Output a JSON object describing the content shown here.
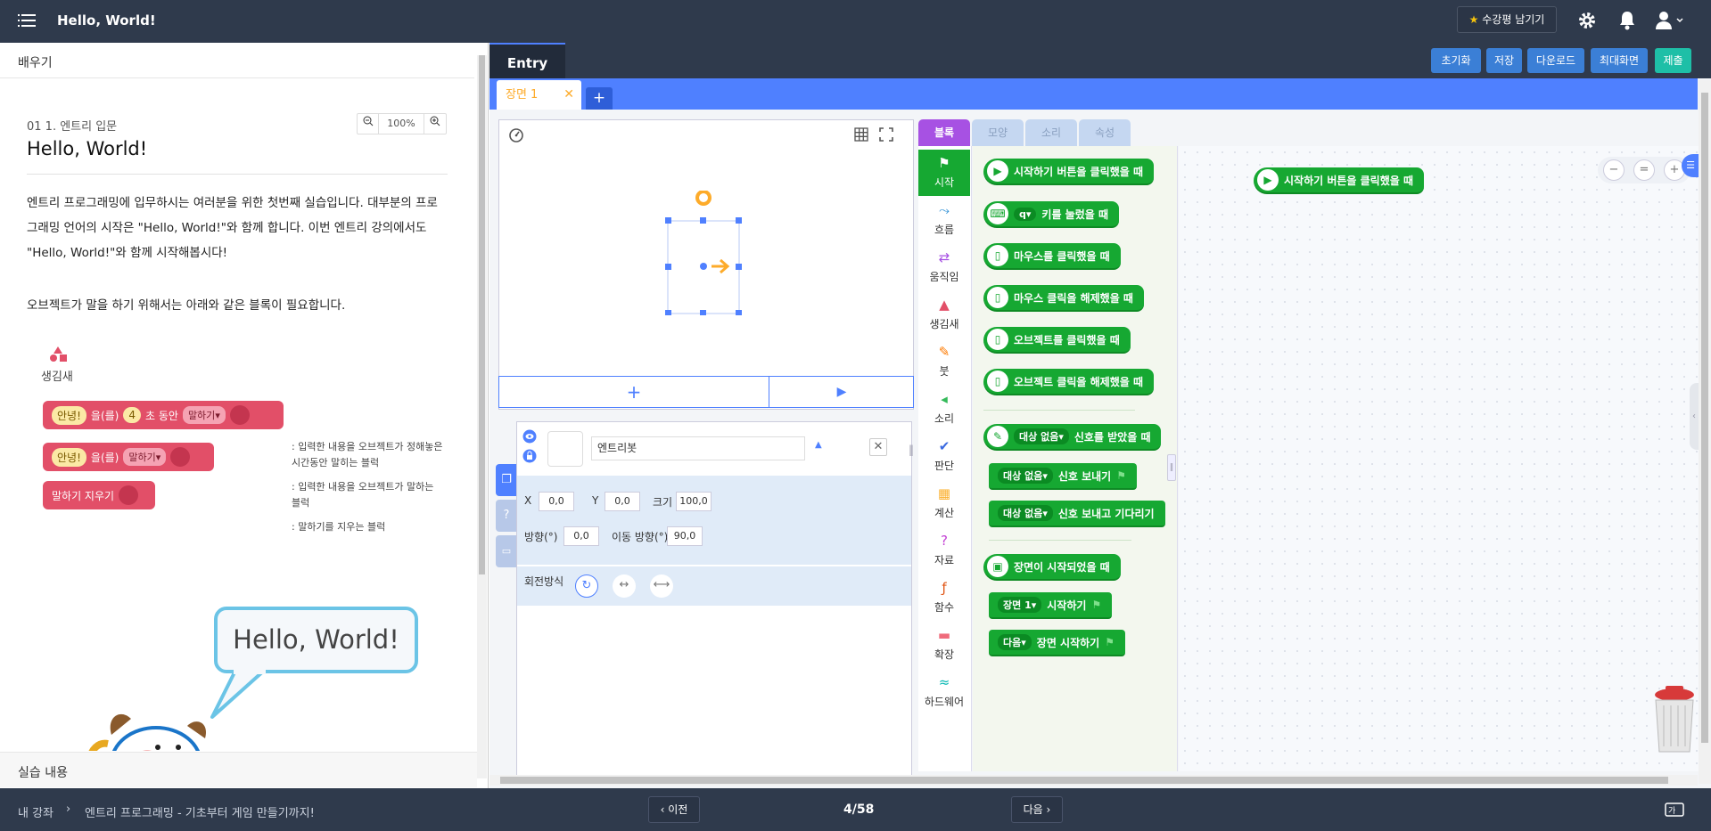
{
  "header": {
    "title": "Hello, World!",
    "review_button": "수강평 남기기"
  },
  "left_panel": {
    "tab_label": "배우기",
    "lesson_subtitle": "01 1. 엔트리 입문",
    "zoom_level": "100%",
    "lesson_title": "Hello, World!",
    "paragraph1": "엔트리 프로그래밍에 입무하시는 여러분을 위한 첫번째 실습입니다. 대부분의 프로그래밍 언어의 시작은 \"Hello, World!\"와 함께 합니다. 이번 엔트리 강의에서도 \"Hello, World!\"와 함께 시작해봅시다!",
    "paragraph2": "오브젝트가 말을 하기 위해서는 아래와 같은 블록이 필요합니다.",
    "shape_category": "생김새",
    "example_blocks": [
      {
        "text1": "안녕!",
        "text2": "을(를)",
        "num": "4",
        "text3": "초 동안",
        "dropdown": "말하기",
        "desc": ": 입력한 내용을 오브젝트가 정해놓은 시간동안 말히는 블럭"
      },
      {
        "text1": "안녕!",
        "text2": "을(를)",
        "dropdown": "말하기",
        "desc": ": 입력한 내용을 오브젝트가 말하는 블럭"
      },
      {
        "text1": "말하기 지우기",
        "desc": ": 말하기를 지우는 블럭"
      }
    ],
    "speech_bubble": "Hello, World!",
    "practice_label": "실습 내용"
  },
  "entry": {
    "tab_label": "Entry",
    "buttons": {
      "reset": "초기화",
      "save": "저장",
      "download": "다운로드",
      "maximize": "최대화면",
      "submit": "제출"
    },
    "scene_tab": "장면 1",
    "object": {
      "name": "엔트리봇",
      "x_label": "X",
      "x": "0,0",
      "y_label": "Y",
      "y": "0,0",
      "size_label": "크기",
      "size": "100,0",
      "direction_label": "방향(°)",
      "direction": "0,0",
      "move_direction_label": "이동 방향(°)",
      "move_direction": "90,0",
      "rotation_label": "회전방식"
    },
    "block_tabs": [
      "블록",
      "모양",
      "소리",
      "속성"
    ],
    "categories": [
      {
        "label": "시작",
        "color": "#16a832"
      },
      {
        "label": "흐름",
        "color": "#2d8fd5"
      },
      {
        "label": "움직임",
        "color": "#a751e3"
      },
      {
        "label": "생김새",
        "color": "#e24f68"
      },
      {
        "label": "붓",
        "color": "#fd7a00"
      },
      {
        "label": "소리",
        "color": "#35ba5a"
      },
      {
        "label": "판단",
        "color": "#3b6ae0"
      },
      {
        "label": "계산",
        "color": "#fbb02e"
      },
      {
        "label": "자료",
        "color": "#c341d4"
      },
      {
        "label": "함수",
        "color": "#e05717"
      },
      {
        "label": "확장",
        "color": "#ef6b7b"
      },
      {
        "label": "하드웨어",
        "color": "#00b6b1"
      }
    ],
    "blocks": {
      "when_start_clicked": "시작하기 버튼을 클릭했을 때",
      "key_pressed_dd": "q",
      "key_pressed": "키를 눌렀을 때",
      "mouse_click": "마우스를 클릭했을 때",
      "mouse_release": "마우스 클릭을 해제했을 때",
      "object_click": "오브젝트를 클릭했을 때",
      "object_release": "오브젝트 클릭을 해제했을 때",
      "signal_dd": "대상 없음",
      "signal_received": "신호를 받았을 때",
      "send_signal": "신호 보내기",
      "send_signal_wait": "신호 보내고 기다리기",
      "scene_started": "장면이 시작되었을 때",
      "scene_dd": "장면 1",
      "start_scene": "시작하기",
      "next_dd": "다음",
      "start_next_scene": "장면 시작하기"
    },
    "canvas_block": "시작하기 버튼을 클릭했을 때"
  },
  "footer": {
    "breadcrumb_home": "내 강좌",
    "breadcrumb_course": "엔트리 프로그래밍 - 기초부터 게임 만들기까지!",
    "prev": "이전",
    "page": "4/58",
    "next": "다음"
  }
}
